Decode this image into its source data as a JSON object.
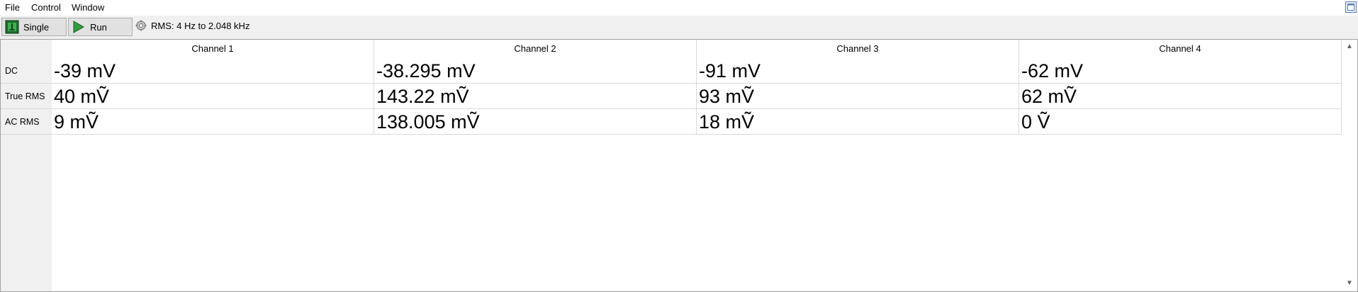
{
  "menu": {
    "items": [
      "File",
      "Control",
      "Window"
    ]
  },
  "toolbar": {
    "single_label": "Single",
    "run_label": "Run",
    "rms_info": "RMS: 4 Hz to 2.048 kHz"
  },
  "table": {
    "columns": [
      "Channel 1",
      "Channel 2",
      "Channel 3",
      "Channel 4"
    ],
    "rows": [
      {
        "label": "DC",
        "values": [
          "-39 mV",
          "-38.295 mV",
          "-91 mV",
          "-62 mV"
        ]
      },
      {
        "label": "True RMS",
        "values": [
          "40 mṼ",
          "143.22 mṼ",
          "93 mṼ",
          "62 mṼ"
        ]
      },
      {
        "label": "AC RMS",
        "values": [
          "9 mṼ",
          "138.005 mṼ",
          "18 mṼ",
          "0 Ṽ"
        ]
      }
    ]
  },
  "colors": {
    "window_bg": "#f0f0f0",
    "table_bg": "#ffffff",
    "gridline": "#d8d8d8",
    "run_icon": "#2e9e3e"
  }
}
